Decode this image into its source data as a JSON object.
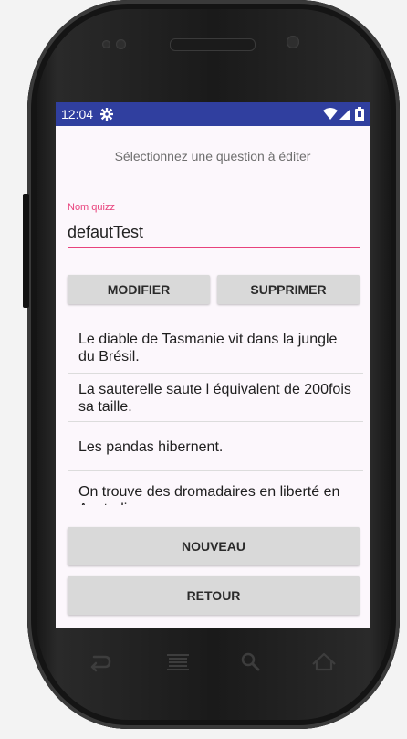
{
  "status_bar": {
    "time": "12:04"
  },
  "screen": {
    "prompt": "Sélectionnez une question à éditer",
    "quiz_name_label": "Nom quizz",
    "quiz_name_value": "defautTest",
    "modify_label": "MODIFIER",
    "delete_label": "SUPPRIMER",
    "questions": [
      "Le diable de Tasmanie vit dans la jungle du Brésil.",
      "La sauterelle saute l équivalent de 200fois sa taille.",
      "Les pandas hibernent.",
      "On trouve des dromadaires en liberté en Australie."
    ],
    "new_label": "NOUVEAU",
    "back_label": "RETOUR"
  },
  "colors": {
    "status_bar": "#303f9f",
    "accent": "#e8427c",
    "screen_background": "#fcf7fc",
    "button": "#d9d9d9"
  },
  "icons": {
    "status": [
      "settings-icon",
      "wifi-icon",
      "signal-icon",
      "battery-icon"
    ],
    "nav": [
      "back-icon",
      "menu-icon",
      "search-icon",
      "home-icon"
    ]
  }
}
